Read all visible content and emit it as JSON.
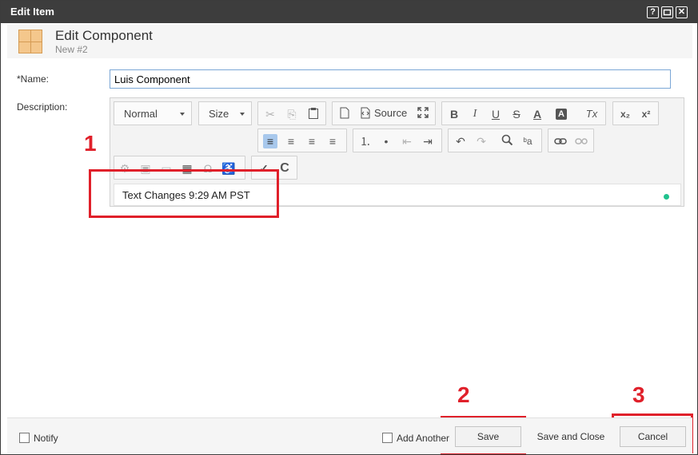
{
  "window": {
    "title": "Edit Item",
    "help": "?",
    "maximize": "□",
    "close": "✕"
  },
  "header": {
    "title": "Edit Component",
    "subtitle": "New #2"
  },
  "form": {
    "name_label": "*Name:",
    "name_value": "Luis Component",
    "description_label": "Description:"
  },
  "toolbar": {
    "format": "Normal",
    "size": "Size",
    "source": "Source",
    "icons": {
      "cut": "✂",
      "copy": "⎘",
      "paste": "📋",
      "new-page": "🗋",
      "source": "⟨⟩",
      "maximize": "⤧",
      "bold": "B",
      "italic": "I",
      "underline": "U",
      "strike": "S",
      "text-color": "A",
      "bg-color": "A",
      "remove-format": "Tx",
      "subscript": "x₂",
      "superscript": "x²",
      "align-left": "≡",
      "align-center": "≡",
      "align-right": "≡",
      "justify": "≡",
      "numbered-list": "⒈",
      "bulleted-list": "•",
      "outdent": "⇤",
      "indent": "⇥",
      "undo": "↶",
      "redo": "↷",
      "find": "🔍",
      "replace": "ᵇa",
      "link": "⛓",
      "unlink": "⛓",
      "image-special": "⚙",
      "image": "▣",
      "folder": "▭",
      "table": "▦",
      "special-char": "Ω",
      "accessibility": "♿",
      "spellcheck": "✓",
      "code": "C"
    }
  },
  "editor": {
    "content": "Text Changes 9:29 AM PST"
  },
  "annotations": [
    "1",
    "2",
    "3"
  ],
  "footer": {
    "notify": "Notify",
    "add_another": "Add Another",
    "save": "Save",
    "save_close": "Save and Close",
    "cancel": "Cancel"
  },
  "colors": {
    "titlebar": "#3d3d3d",
    "annotation": "#e0202a",
    "status_dot": "#21c28e"
  }
}
